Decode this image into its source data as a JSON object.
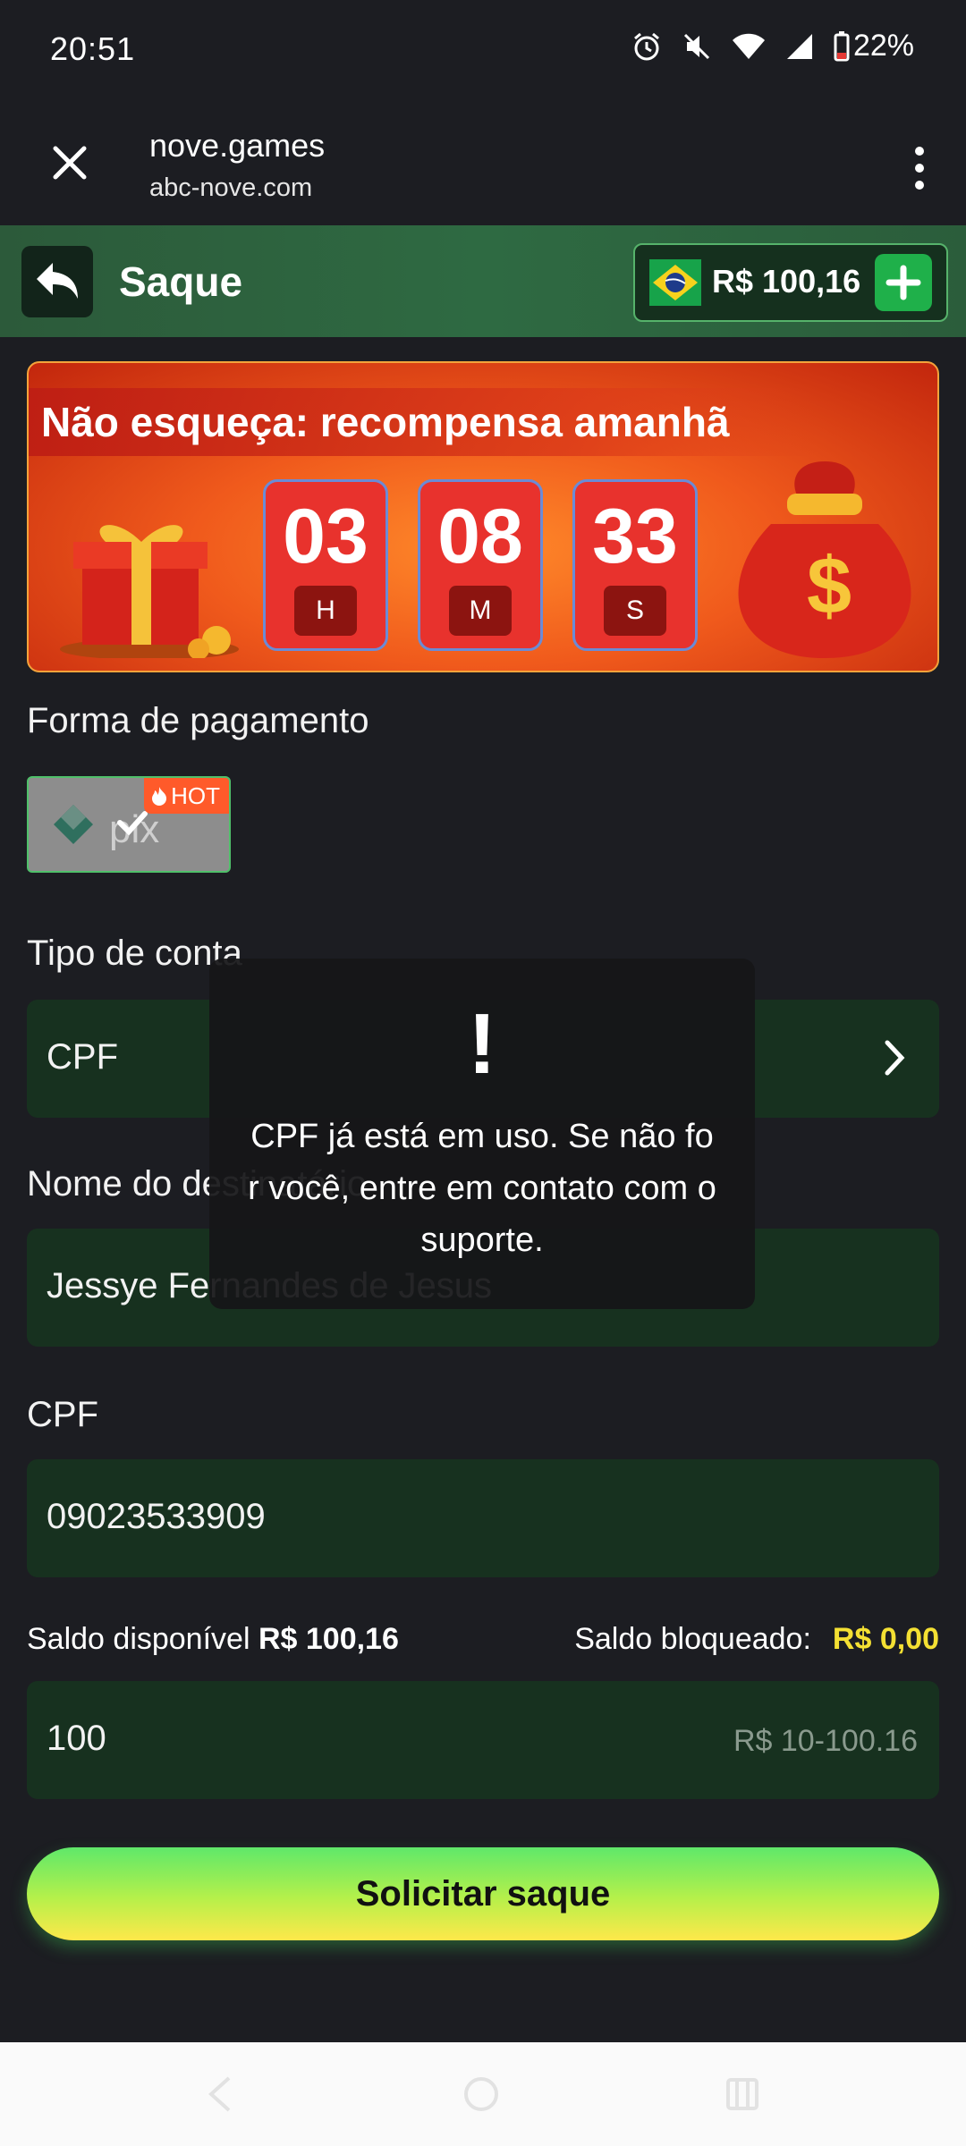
{
  "status_bar": {
    "time": "20:51",
    "battery": "22%",
    "icons": [
      "alarm-icon",
      "mute-icon",
      "wifi-icon",
      "signal-icon",
      "battery-icon"
    ]
  },
  "browser": {
    "title": "nove.games",
    "url": "abc-nove.com"
  },
  "header": {
    "title": "Saque",
    "balance": "R$ 100,16"
  },
  "banner": {
    "headline": "Não esqueça: recompensa amanhã",
    "timer": [
      {
        "value": "03",
        "unit": "H"
      },
      {
        "value": "08",
        "unit": "M"
      },
      {
        "value": "33",
        "unit": "S"
      }
    ]
  },
  "form": {
    "payment_label": "Forma de pagamento",
    "payment_badge": "HOT",
    "account_type_label": "Tipo de conta",
    "account_type_value": "CPF",
    "recipient_label": "Nome do destinatário",
    "recipient_value": "Jessye Fernandes de Jesus",
    "cpf_label": "CPF",
    "cpf_value": "09023533909",
    "available_label": "Saldo disponível",
    "available_value": "R$ 100,16",
    "blocked_label": "Saldo bloqueado:",
    "blocked_value": "R$ 0,00",
    "amount_value": "100",
    "amount_range": "R$ 10-100.16",
    "submit_label": "Solicitar saque"
  },
  "toast": {
    "symbol": "!",
    "message": "CPF já está em uso. Se não for você, entre em contato com o suporte."
  },
  "colors": {
    "accent_green": "#1fb04a",
    "field_bg": "#17311f",
    "blocked_yellow": "#f4e033",
    "banner_red": "#e8322d"
  }
}
